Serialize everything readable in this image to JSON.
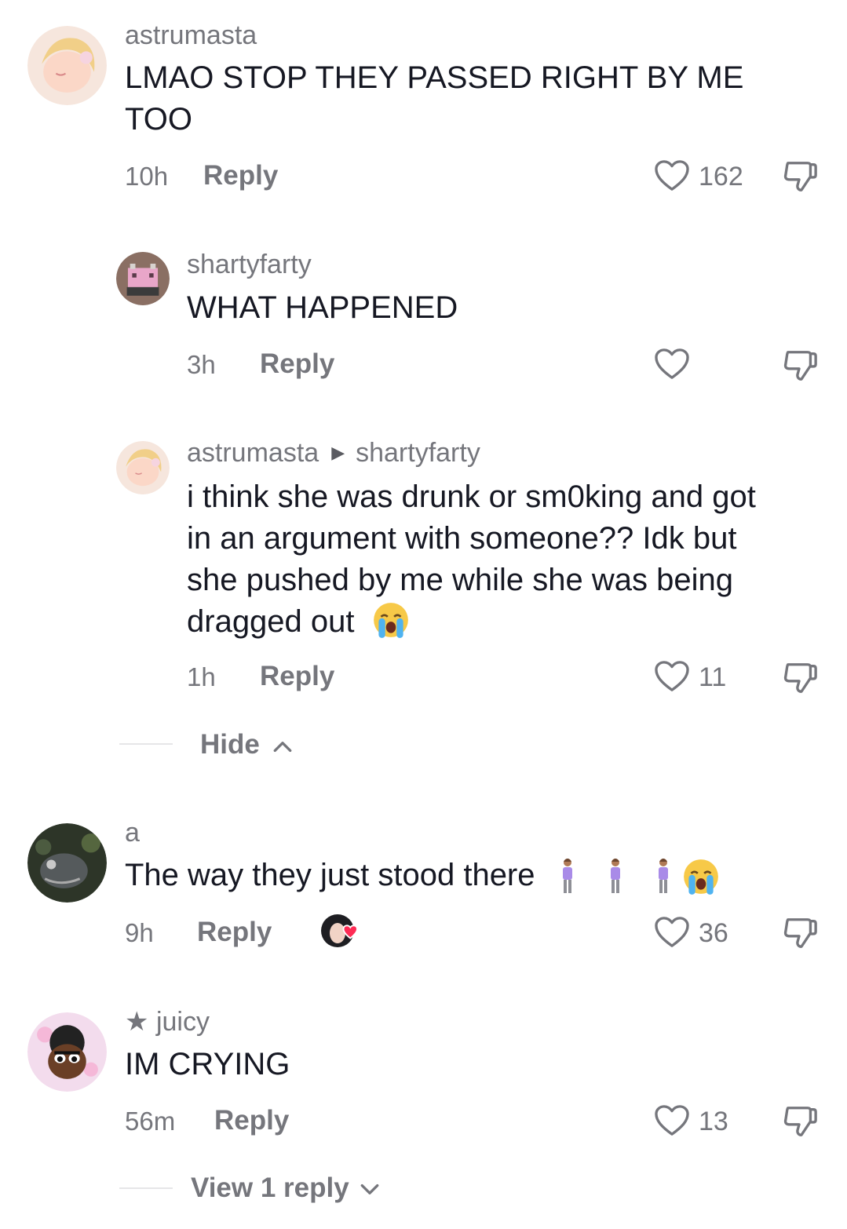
{
  "comments": [
    {
      "username": "astrumasta",
      "text_lines": [
        "LMAO STOP THEY PASSED RIGHT BY ME",
        "TOO"
      ],
      "time": "10h",
      "reply_label": "Reply",
      "likes": "162",
      "replies": [
        {
          "username": "shartyfarty",
          "text": "WHAT HAPPENED",
          "time": "3h",
          "reply_label": "Reply",
          "likes": ""
        },
        {
          "username": "astrumasta",
          "reply_to": "shartyfarty",
          "text_lines": [
            "i think she was drunk or sm0king and got",
            "in an argument with someone?? Idk but",
            "she pushed by me while she was being",
            "dragged out"
          ],
          "time": "1h",
          "reply_label": "Reply",
          "likes": "11"
        }
      ],
      "hide_label": "Hide"
    },
    {
      "username": "a",
      "text": "The way they just stood there",
      "time": "9h",
      "reply_label": "Reply",
      "likes": "36"
    },
    {
      "username": "juicy",
      "username_prefix": "★",
      "text": "IM CRYING",
      "time": "56m",
      "reply_label": "Reply",
      "likes": "13",
      "view_replies_label": "View 1 reply"
    }
  ],
  "icons": {
    "heart": "heart-outline-icon",
    "dislike": "thumbs-down-icon",
    "collapse": "chevron-up-icon",
    "expand": "chevron-down-icon",
    "mention_arrow": "triangle-right-icon",
    "creator_liked": "creator-liked-avatar-icon",
    "emoji_cry": "loudly-crying-face-emoji",
    "emoji_person": "person-standing-emoji"
  },
  "colors": {
    "muted_text": "#75767c",
    "primary_text": "#161823",
    "heart_badge": "#fe2c55"
  }
}
